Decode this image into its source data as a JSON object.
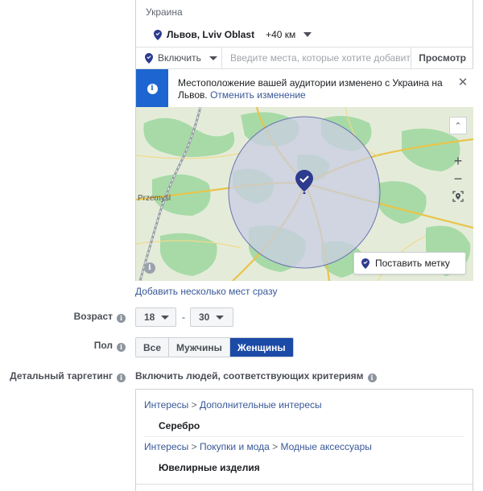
{
  "location": {
    "country": "Украина",
    "selected_name": "Львов, Lviv Oblast",
    "radius": "+40 км",
    "include_label": "Включить",
    "search_placeholder": "Введите места, которые хотите добавить",
    "browse_label": "Просмотр",
    "notice_text": "Местоположение вашей аудитории изменено с Украина на Львов.",
    "notice_link": "Отменить изменение",
    "map_city_label": "Przemyśl",
    "drop_pin_label": "Поставить метку",
    "add_many_link": "Добавить несколько мест сразу"
  },
  "age": {
    "label": "Возраст",
    "min": "18",
    "max": "30",
    "separator": "-"
  },
  "gender": {
    "label": "Пол",
    "options": [
      "Все",
      "Мужчины",
      "Женщины"
    ],
    "selected": "Женщины"
  },
  "detailed_targeting": {
    "label": "Детальный таргетинг",
    "description": "Включить людей, соответствующих критериям",
    "entries": [
      {
        "path": [
          "Интересы",
          "Дополнительные интересы"
        ],
        "item": "Серебро"
      },
      {
        "path": [
          "Интересы",
          "Покупки и мода",
          "Модные аксессуары"
        ],
        "item": "Ювелирные изделия"
      }
    ],
    "path_separator": ">"
  },
  "colors": {
    "accent_blue": "#1d65d0",
    "selected_segment": "#1b4aa7",
    "link": "#385898",
    "map_pin": "#2d3b8e",
    "radius_fill": "#c9cde3"
  }
}
